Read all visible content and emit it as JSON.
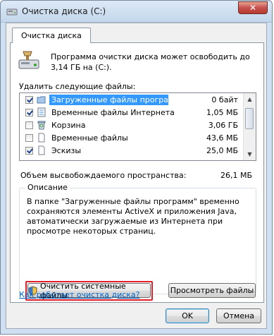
{
  "window": {
    "title": "Очистка диска  (C:)",
    "close_glyph": "✕"
  },
  "tab": {
    "label": "Очистка диска"
  },
  "summary": {
    "text": "Программа очистки диска может освободить до 3,14 ГБ на  (C:)."
  },
  "files_section": {
    "label": "Удалить следующие файлы:",
    "items": [
      {
        "name": "Загруженные файлы программ",
        "size": "0 байт",
        "checked": true,
        "selected": true,
        "icon": "folder-icon"
      },
      {
        "name": "Временные файлы Интернета",
        "size": "1,05 МБ",
        "checked": true,
        "selected": false,
        "icon": "internet-page-icon"
      },
      {
        "name": "Корзина",
        "size": "3,06 ГБ",
        "checked": false,
        "selected": false,
        "icon": "recycle-bin-icon"
      },
      {
        "name": "Временные файлы",
        "size": "43,6 МБ",
        "checked": false,
        "selected": false,
        "icon": "blank-file-icon"
      },
      {
        "name": "Эскизы",
        "size": "25,0 МБ",
        "checked": true,
        "selected": false,
        "icon": "blank-file-icon"
      }
    ]
  },
  "freed": {
    "label": "Объем высвобождаемого пространства:",
    "value": "26,1 МБ"
  },
  "description": {
    "legend": "Описание",
    "text": "В папке \"Загруженные файлы программ\" временно сохраняются элементы ActiveX и приложения Java, автоматически загружаемые из Интернета при просмотре некоторых страниц."
  },
  "buttons": {
    "cleanup_system": "Очистить системные файлы",
    "view_files": "Просмотреть файлы",
    "ok": "OK",
    "cancel": "Отмена"
  },
  "help_link": "Как работает очистка диска?",
  "colors": {
    "highlight_box": "#e0212b",
    "selection": "#3399ff",
    "link": "#0066cc"
  }
}
